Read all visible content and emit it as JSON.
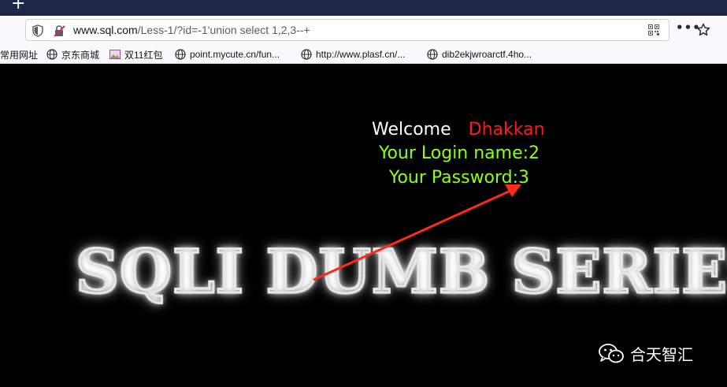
{
  "browser": {
    "new_tab_glyph": "+",
    "address": {
      "scheme_host": "www.sql.com",
      "path": "/Less-1/?id=-1'union select 1,2,3--+"
    },
    "more_glyph": "•••"
  },
  "bookmarks": [
    {
      "label": "常用网址",
      "icon": "none"
    },
    {
      "label": "京东商城",
      "icon": "globe-icon"
    },
    {
      "label": "双11红包",
      "icon": "image-icon"
    },
    {
      "label": "point.mycute.cn/fun...",
      "icon": "globe-icon"
    },
    {
      "label": "http://www.plasf.cn/...",
      "icon": "globe-icon"
    },
    {
      "label": "dib2ekjwroarctf.4ho...",
      "icon": "globe-icon"
    }
  ],
  "page": {
    "welcome": "Welcome",
    "user_name": "Dhakkan",
    "login_name": "Your Login name:2",
    "password": "Your Password:3",
    "banner": "SQLI DUMB SERIES"
  },
  "watermark": {
    "text": "合天智汇",
    "icon": "wechat-icon"
  },
  "colors": {
    "welcome": "#ffffff",
    "user_name": "#ff1a1a",
    "result_text": "#8cff1a",
    "arrow": "#ff2a1a",
    "background": "#000000"
  }
}
